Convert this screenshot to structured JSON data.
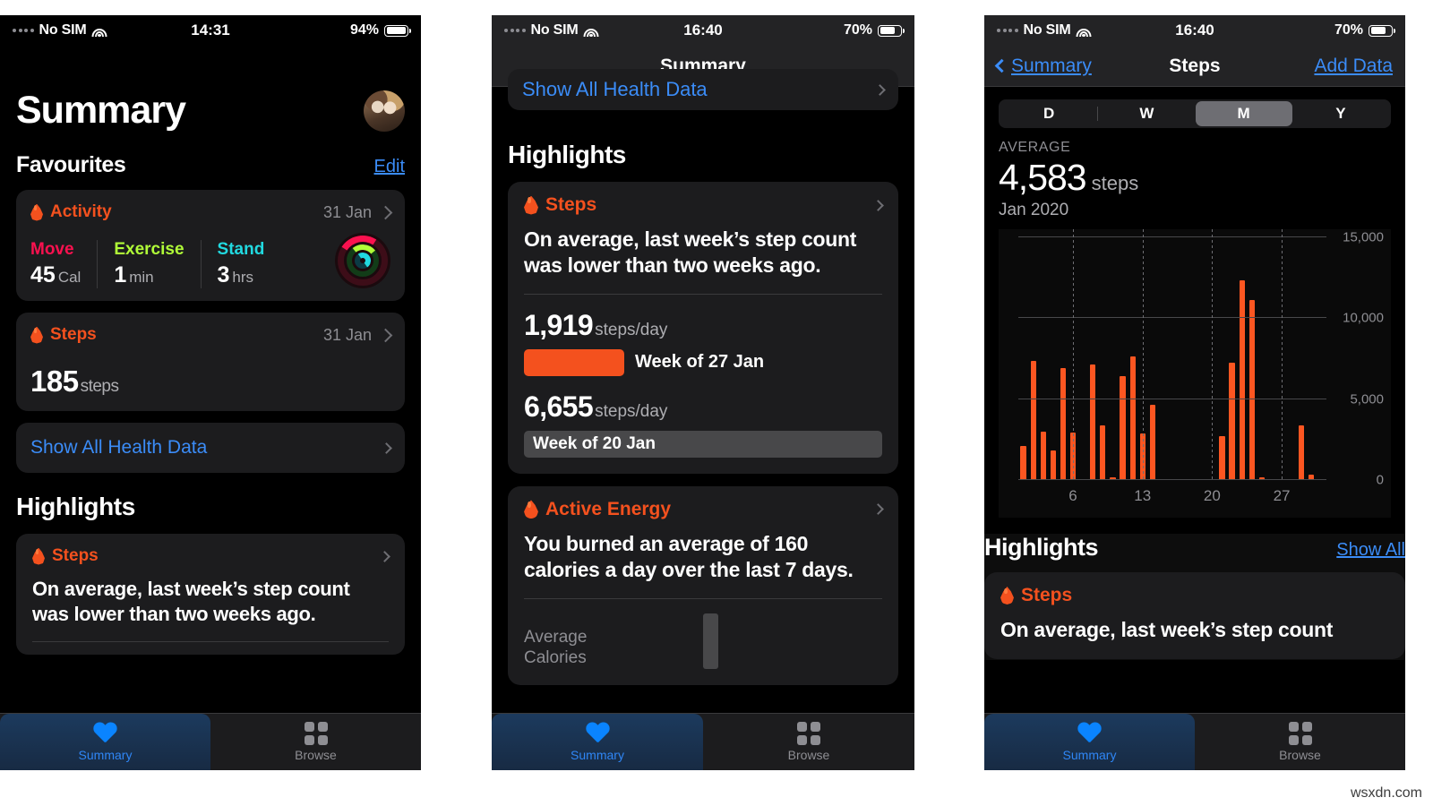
{
  "watermark": "wsxdn.com",
  "panel1": {
    "status": {
      "carrier": "No SIM",
      "time": "14:31",
      "battery": "94%"
    },
    "title": "Summary",
    "favourites": {
      "heading": "Favourites",
      "edit": "Edit"
    },
    "activity_card": {
      "name": "Activity",
      "date": "31 Jan",
      "metrics": [
        {
          "label": "Move",
          "value": "45",
          "unit": "Cal"
        },
        {
          "label": "Exercise",
          "value": "1",
          "unit": "min"
        },
        {
          "label": "Stand",
          "value": "3",
          "unit": "hrs"
        }
      ]
    },
    "steps_card": {
      "name": "Steps",
      "date": "31 Jan",
      "value": "185",
      "unit": "steps"
    },
    "show_all": "Show All Health Data",
    "highlights": {
      "heading": "Highlights",
      "card": {
        "name": "Steps",
        "text": "On average, last week’s step count was lower than two weeks ago."
      }
    },
    "tabs": [
      {
        "label": "Summary",
        "icon": "heart-icon",
        "active": true
      },
      {
        "label": "Browse",
        "icon": "grid-icon",
        "active": false
      }
    ]
  },
  "panel2": {
    "status": {
      "carrier": "No SIM",
      "time": "16:40",
      "battery": "70%"
    },
    "nav_title": "Summary",
    "scrolled_row": "Show All Health Data",
    "highlights_heading": "Highlights",
    "steps_card": {
      "name": "Steps",
      "text": "On average, last week’s step count was lower than two weeks ago.",
      "rows": [
        {
          "value": "1,919",
          "unit": "steps/day",
          "bar_label": "Week of 27 Jan",
          "bar_style": "orange"
        },
        {
          "value": "6,655",
          "unit": "steps/day",
          "bar_label": "Week of 20 Jan",
          "bar_style": "grey"
        }
      ]
    },
    "energy_card": {
      "name": "Active Energy",
      "text": "You burned an average of 160 calories a day over the last 7 days.",
      "caption_line1": "Average",
      "caption_line2": "Calories"
    },
    "tabs": [
      {
        "label": "Summary",
        "icon": "heart-icon",
        "active": true
      },
      {
        "label": "Browse",
        "icon": "grid-icon",
        "active": false
      }
    ]
  },
  "panel3": {
    "status": {
      "carrier": "No SIM",
      "time": "16:40",
      "battery": "70%"
    },
    "nav": {
      "back": "Summary",
      "title": "Steps",
      "action": "Add Data"
    },
    "segments": [
      {
        "label": "D",
        "selected": false
      },
      {
        "label": "W",
        "selected": false
      },
      {
        "label": "M",
        "selected": true
      },
      {
        "label": "Y",
        "selected": false
      }
    ],
    "average_label": "AVERAGE",
    "average_value": "4,583",
    "average_unit": "steps",
    "period": "Jan 2020",
    "highlights": {
      "heading": "Highlights",
      "show_all": "Show All",
      "card": {
        "name": "Steps",
        "text": "On average, last week’s step count"
      }
    },
    "tabs": [
      {
        "label": "Summary",
        "icon": "heart-icon",
        "active": true
      },
      {
        "label": "Browse",
        "icon": "grid-icon",
        "active": false
      }
    ]
  },
  "chart_data": {
    "type": "bar",
    "title": "Steps",
    "subtitle": "Jan 2020",
    "xlabel": "",
    "ylabel": "steps",
    "ylim": [
      0,
      15500
    ],
    "yticks": [
      0,
      5000,
      10000,
      15000
    ],
    "ytick_labels": [
      "0",
      "5,000",
      "10,000",
      "15,000"
    ],
    "xticks": [
      6,
      13,
      20,
      27
    ],
    "xtick_labels": [
      "6",
      "13",
      "20",
      "27"
    ],
    "grid": true,
    "bar_color": "#fc5621",
    "categories": [
      1,
      2,
      3,
      4,
      5,
      6,
      7,
      8,
      9,
      10,
      11,
      12,
      13,
      14,
      15,
      16,
      17,
      18,
      19,
      20,
      21,
      22,
      23,
      24,
      25,
      26,
      27,
      28,
      29,
      30,
      31
    ],
    "values": [
      2100,
      7350,
      3000,
      1800,
      6900,
      2950,
      0,
      7150,
      3350,
      120,
      6400,
      7650,
      2900,
      4650,
      0,
      0,
      0,
      0,
      0,
      0,
      2700,
      7250,
      12350,
      11150,
      180,
      0,
      0,
      0,
      3400,
      350,
      0
    ]
  }
}
